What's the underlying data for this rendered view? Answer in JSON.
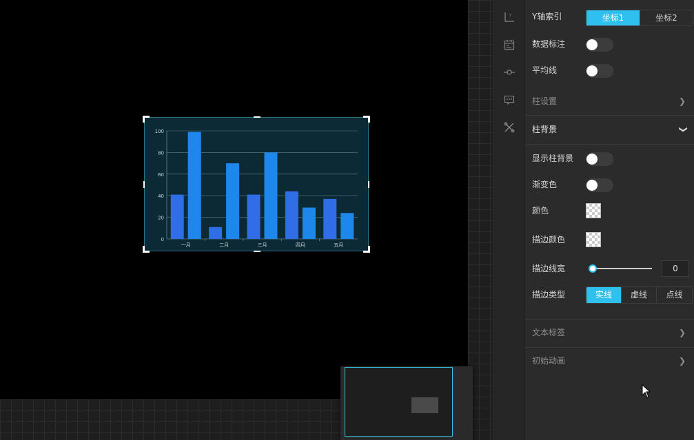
{
  "chart_data": {
    "type": "bar",
    "categories": [
      "一月",
      "二月",
      "三月",
      "四月",
      "五月"
    ],
    "series": [
      {
        "values": [
          41,
          11,
          41,
          44,
          37
        ],
        "color": "#2f6ee6"
      },
      {
        "values": [
          99,
          70,
          80,
          29,
          24
        ],
        "color": "#1e88ea"
      }
    ],
    "y_ticks": [
      "0",
      "20",
      "40",
      "60",
      "80",
      "100"
    ],
    "ylim": [
      0,
      100
    ],
    "grid": true,
    "background": "#0b2a35"
  },
  "panel": {
    "y_axis_index": {
      "label": "Y轴索引",
      "options": [
        "坐标1",
        "坐标2"
      ],
      "selected": "坐标1"
    },
    "data_marker": {
      "label": "数据标注",
      "on": false
    },
    "average_line": {
      "label": "平均线",
      "on": false
    },
    "bar_settings": {
      "label": "柱设置",
      "expanded": false
    },
    "bar_background": {
      "label": "柱背景",
      "expanded": true,
      "show_bar_background": {
        "label": "显示柱背景",
        "on": false
      },
      "gradient": {
        "label": "渐变色",
        "on": false
      },
      "color": {
        "label": "颜色"
      },
      "stroke_color": {
        "label": "描边颜色"
      },
      "stroke_width": {
        "label": "描边线宽",
        "value": "0"
      },
      "stroke_type": {
        "label": "描边类型",
        "options": [
          "实线",
          "虚线",
          "点线"
        ],
        "selected": "实线"
      }
    },
    "text_label": {
      "label": "文本标签",
      "expanded": false
    },
    "initial_animation": {
      "label": "初始动画",
      "expanded": false
    }
  },
  "icons": [
    "axis-icon",
    "calendar-data-icon",
    "line-node-icon",
    "message-icon",
    "tools-icon"
  ],
  "colors": {
    "accent": "#2ec1f0",
    "panel_bg": "#2b2b2b",
    "canvas_bg": "#000000"
  }
}
